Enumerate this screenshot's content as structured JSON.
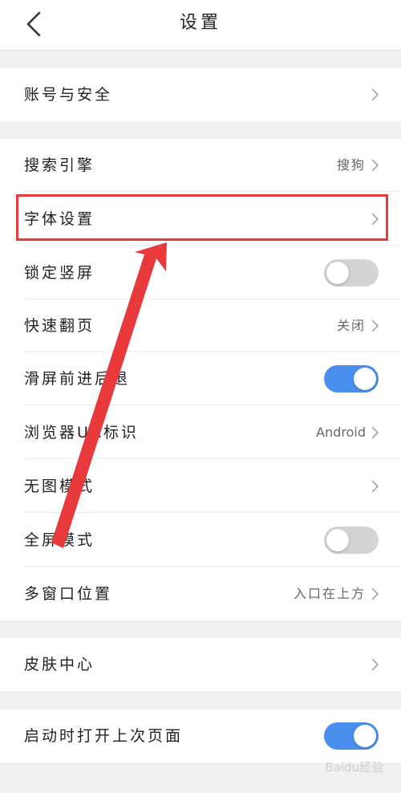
{
  "header": {
    "title": "设置"
  },
  "groups": [
    {
      "items": [
        {
          "label": "账号与安全",
          "type": "link"
        }
      ]
    },
    {
      "items": [
        {
          "label": "搜索引擎",
          "value": "搜狗",
          "type": "link"
        },
        {
          "label": "字体设置",
          "type": "link"
        },
        {
          "label": "锁定竖屏",
          "type": "toggle",
          "on": false
        },
        {
          "label": "快速翻页",
          "value": "关闭",
          "type": "link"
        },
        {
          "label": "滑屏前进后退",
          "type": "toggle",
          "on": true
        },
        {
          "label": "浏览器UA标识",
          "value": "Android",
          "type": "link"
        },
        {
          "label": "无图模式",
          "type": "link"
        },
        {
          "label": "全屏模式",
          "type": "toggle",
          "on": false
        },
        {
          "label": "多窗口位置",
          "value": "入口在上方",
          "type": "link"
        }
      ]
    },
    {
      "items": [
        {
          "label": "皮肤中心",
          "type": "link"
        }
      ]
    },
    {
      "items": [
        {
          "label": "启动时打开上次页面",
          "type": "toggle",
          "on": true
        }
      ]
    }
  ],
  "watermark": "Baidu经验",
  "colors": {
    "accent": "#4a8fed",
    "highlight": "#e8393c",
    "toggle_off": "#d4d4d4"
  },
  "icons": {
    "back": "chevron-left-icon",
    "row": "chevron-right-icon"
  }
}
